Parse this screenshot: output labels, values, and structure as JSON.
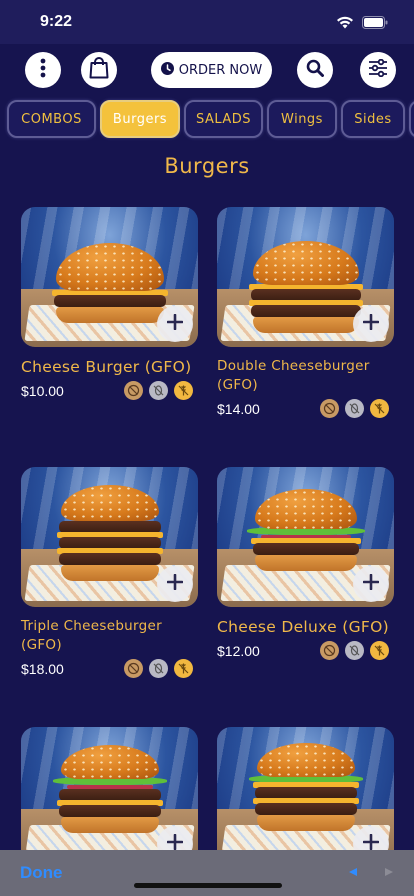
{
  "status": {
    "time": "9:22"
  },
  "topbar": {
    "order_label": "ORDER NOW",
    "icons": [
      "more-vertical-icon",
      "shopping-bag-icon",
      "clock-icon",
      "search-icon",
      "sliders-icon"
    ]
  },
  "categories": [
    {
      "label": "COMBOS",
      "active": false
    },
    {
      "label": "Burgers",
      "active": true
    },
    {
      "label": "SALADS",
      "active": false
    },
    {
      "label": "Wings",
      "active": false
    },
    {
      "label": "Sides",
      "active": false
    }
  ],
  "section_title": "Burgers",
  "products": [
    {
      "name": "Cheese Burger (GFO)",
      "price": "$10.00"
    },
    {
      "name": "Double Cheeseburger (GFO)",
      "price": "$14.00"
    },
    {
      "name": "Triple Cheeseburger (GFO)",
      "price": "$18.00"
    },
    {
      "name": "Cheese Deluxe (GFO)",
      "price": "$12.00"
    },
    {
      "name": "",
      "price": ""
    },
    {
      "name": "",
      "price": ""
    }
  ],
  "diet_icons": [
    "no-dairy-icon",
    "no-nuts-icon",
    "no-gluten-icon"
  ],
  "colors": {
    "background": "#16144f",
    "accent": "#f0b84a",
    "active_tab": "#f4c23c",
    "done": "#2f8cff"
  },
  "bottom_bar": {
    "done_label": "Done"
  }
}
